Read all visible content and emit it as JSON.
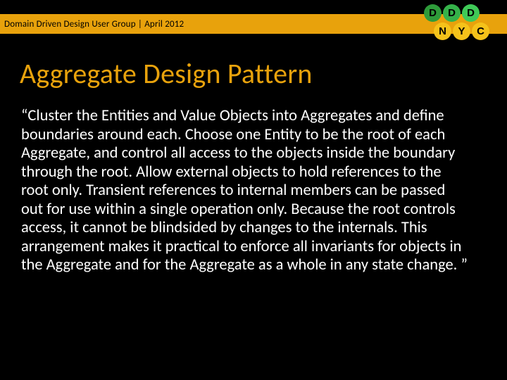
{
  "header": {
    "text": "Domain Driven Design User Group | April 2012"
  },
  "logo": {
    "top": [
      "D",
      "D",
      "D"
    ],
    "bottom": [
      "N",
      "Y",
      "C"
    ]
  },
  "title": "Aggregate Design Pattern",
  "body": "“Cluster the Entities and Value Objects into Aggregates and define boundaries around each. Choose one Entity to be the root of each Aggregate, and control all access to the objects inside the boundary through the root. Allow external objects to hold references to the root only. Transient references to internal members can be passed out for use within a single operation only. Because the root controls access, it cannot be blindsided by changes to the internals. This arrangement makes it practical to enforce all invariants for objects in the Aggregate and for the Aggregate as a whole in any state change. ”"
}
